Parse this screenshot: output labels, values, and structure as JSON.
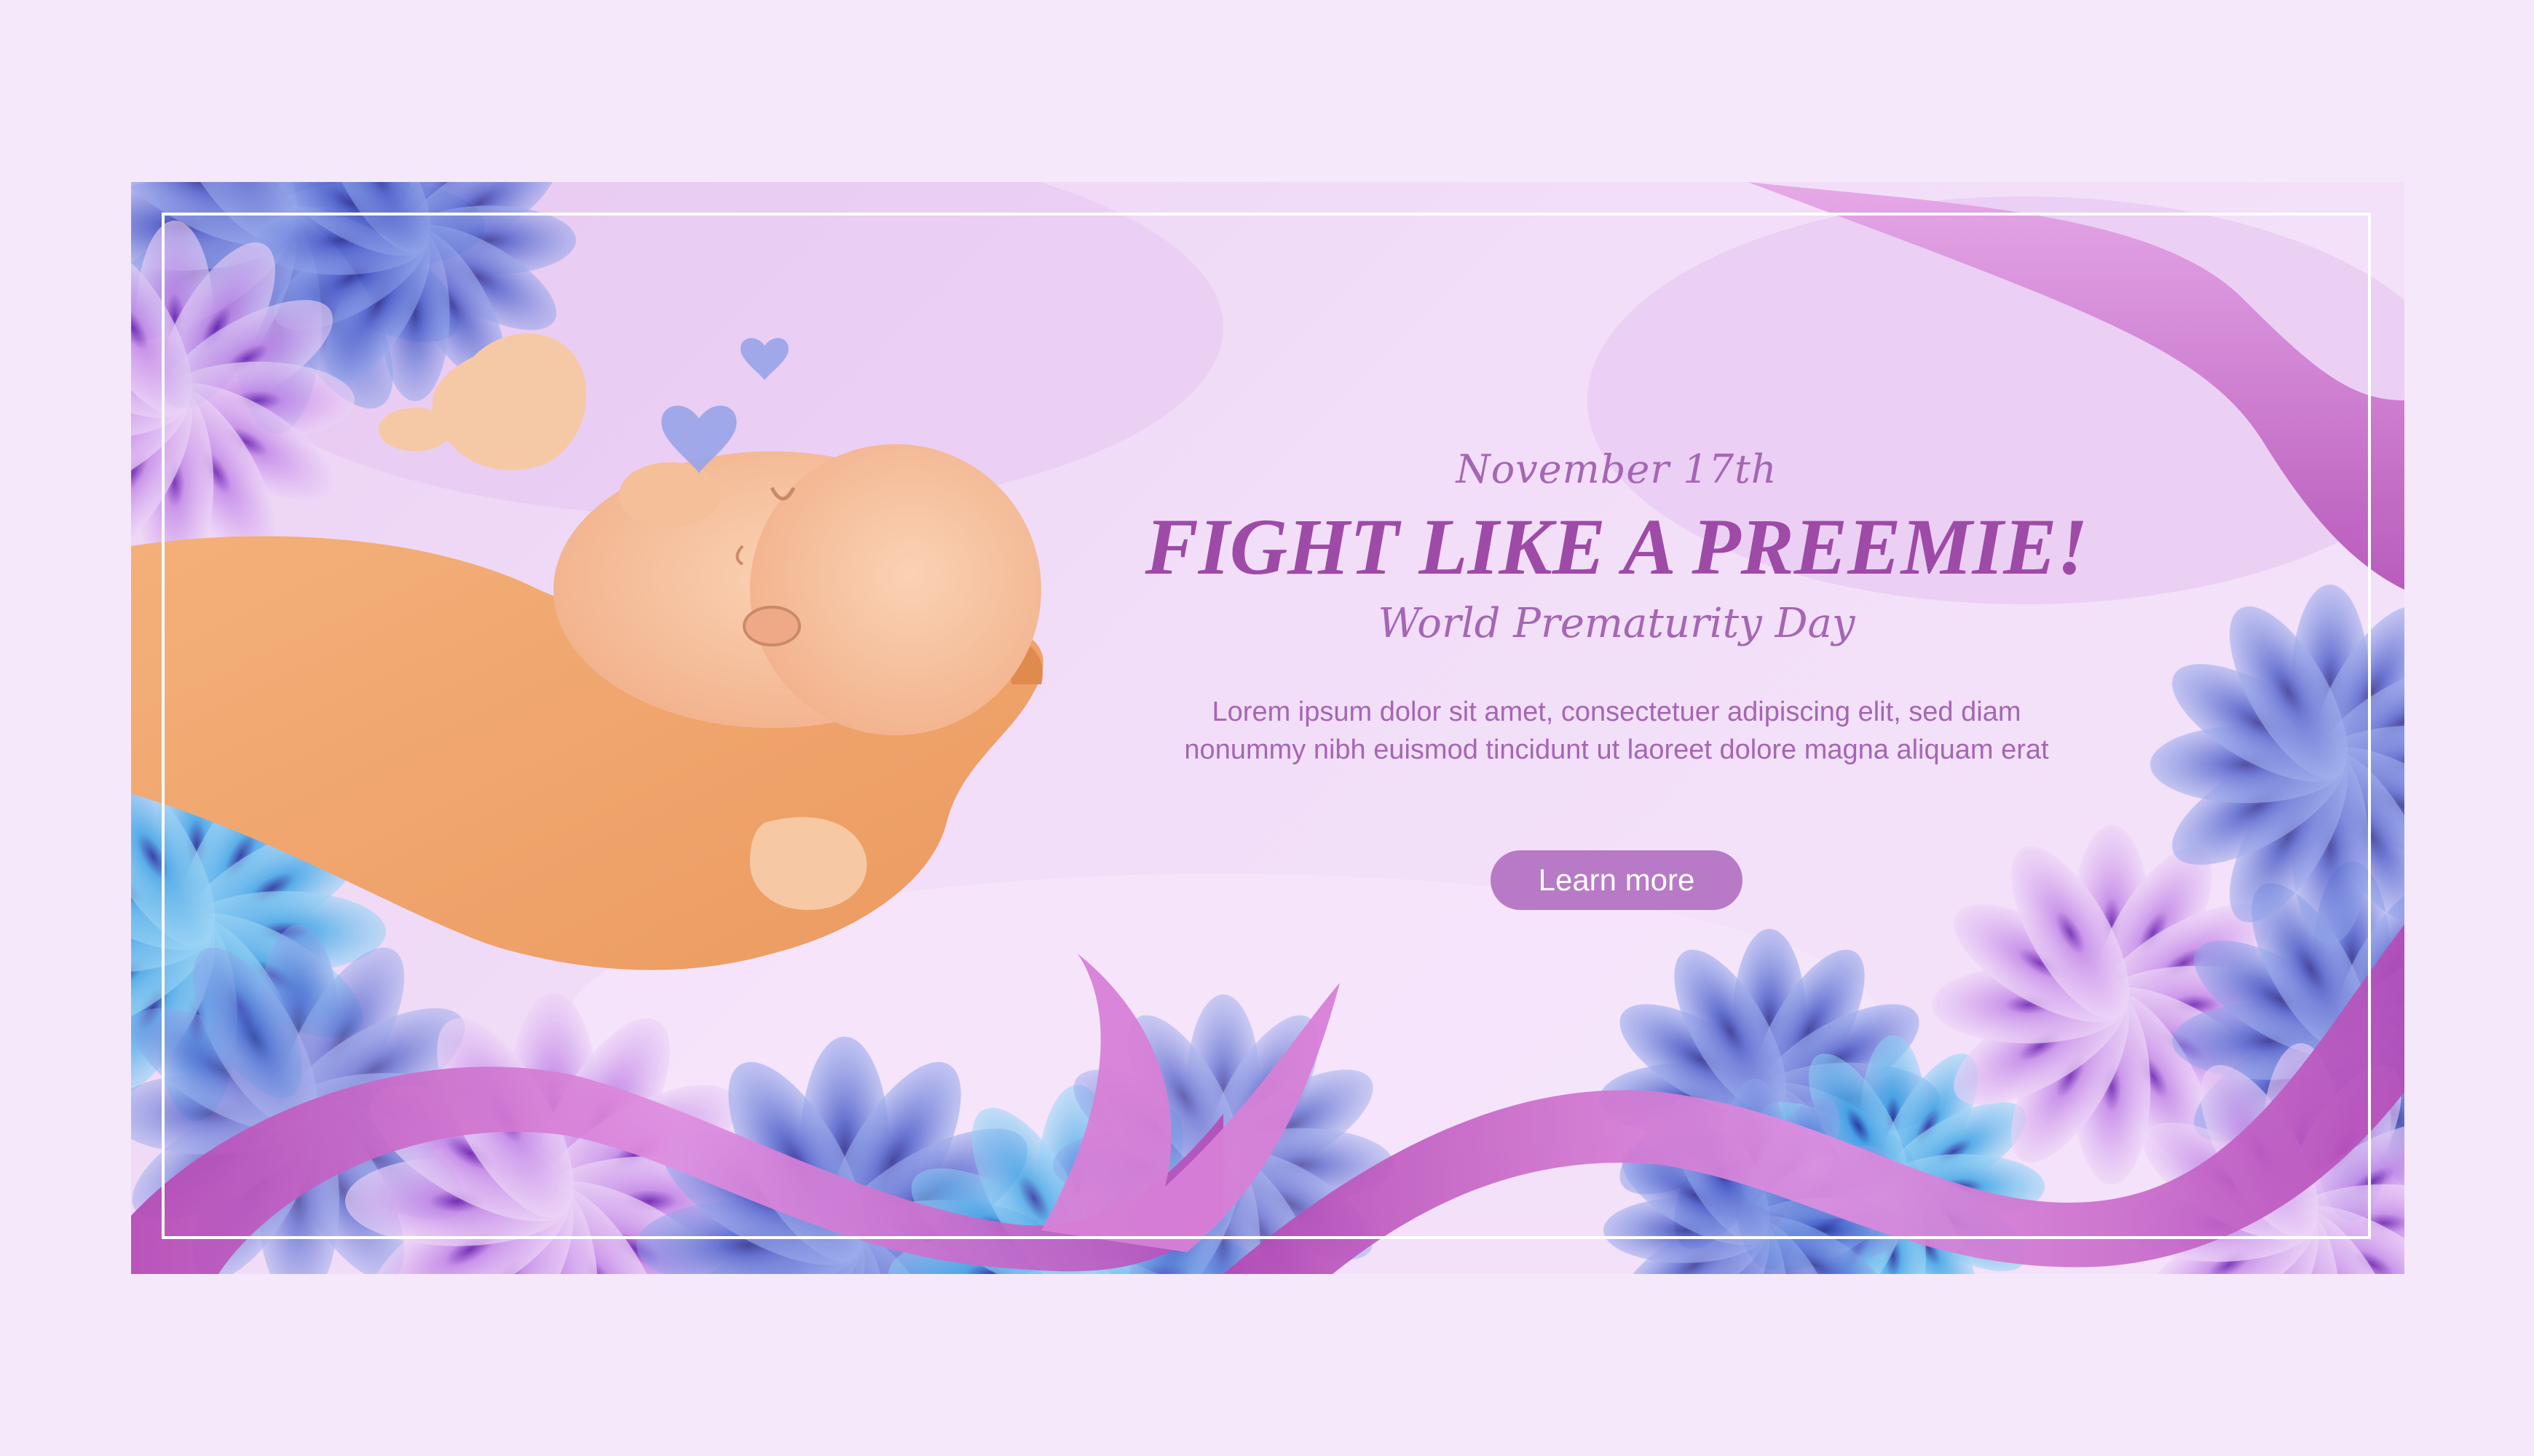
{
  "banner": {
    "date": "November 17th",
    "headline": "FIGHT LIKE A PREEMIE!",
    "subtitle": "World Prematurity Day",
    "body_line1": "Lorem ipsum dolor sit amet, consectetuer adipiscing elit, sed diam",
    "body_line2": "nonummy nibh euismod tincidunt ut laoreet dolore magna aliquam erat",
    "cta_label": "Learn more"
  },
  "colors": {
    "page_background": "#f6e8fb",
    "banner_background": "#f0daf7",
    "text_purple": "#a566b4",
    "headline_purple": "#9e4aa7",
    "button_purple": "#b87ac7",
    "ribbon_magenta": "#c24ebf",
    "flower_blue": "#5b6fd0",
    "flower_cyan": "#3fb2e6",
    "flower_lilac": "#d7a7ee",
    "skin": "#f3b58c"
  },
  "icons": [
    "heart-icon",
    "flower-icon",
    "ribbon-icon",
    "hand-holding-baby-illustration"
  ]
}
